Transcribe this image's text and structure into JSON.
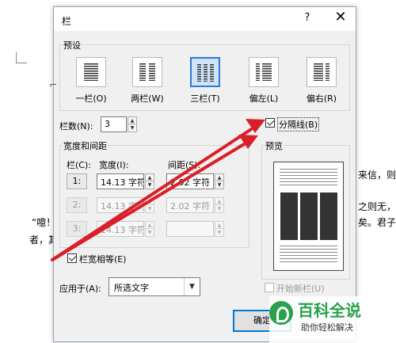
{
  "document": {
    "text_right_1": "来信，则",
    "text_right_2": "之则无，",
    "text_line_1": "“噫！",
    "text_right_3": "矣。君子",
    "text_line_2": "者，其"
  },
  "dialog": {
    "title": "栏",
    "help": "?",
    "close": "✕",
    "presets_label": "预设",
    "presets": [
      {
        "label": "一栏(O)",
        "selected": false
      },
      {
        "label": "两栏(W)",
        "selected": false
      },
      {
        "label": "三栏(T)",
        "selected": true
      },
      {
        "label": "偏左(L)",
        "selected": false
      },
      {
        "label": "偏右(R)",
        "selected": false
      }
    ],
    "num_cols_label": "栏数(N):",
    "num_cols_value": "3",
    "separator_label": "分隔线(B)",
    "separator_checked": true,
    "width_spacing_label": "宽度和间距",
    "preview_label": "预览",
    "col_header": "栏(C):",
    "width_header": "宽度(I):",
    "spacing_header": "间距(S):",
    "rows": [
      {
        "num": "1:",
        "width": "14.13 字符",
        "spacing": "2.02 字符"
      },
      {
        "num": "2:",
        "width": "14.13 字符",
        "spacing": "2.02 字符"
      },
      {
        "num": "3:",
        "width": "14.13 字符",
        "spacing": ""
      }
    ],
    "equal_width_label": "栏宽相等(E)",
    "equal_width_checked": true,
    "apply_to_label": "应用于(A):",
    "apply_to_value": "所选文字",
    "new_column_label": "开始新栏(U)",
    "new_column_checked": false,
    "ok_label": "确定"
  },
  "watermark": {
    "title": "百科全说",
    "subtitle": "助你轻松解决"
  },
  "colors": {
    "accent": "#0078d7",
    "arrow": "#d9202a",
    "watermark_green": "#2aa14a"
  }
}
